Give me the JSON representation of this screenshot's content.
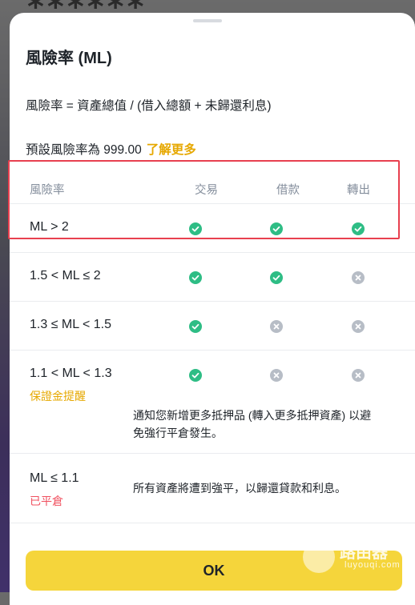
{
  "background": {
    "masked_text": "******"
  },
  "sheet": {
    "title": "風險率 (ML)",
    "formula": "風險率 = 資產總值 / (借入總額 + 未歸還利息)",
    "default_prefix": "預設風險率為 999.00",
    "learn_more": "了解更多"
  },
  "table": {
    "headers": [
      "風險率",
      "交易",
      "借款",
      "轉出"
    ],
    "rows": [
      {
        "ml": "ML > 2",
        "trade": "ok",
        "borrow": "ok",
        "transfer": "ok",
        "tag": "",
        "note": ""
      },
      {
        "ml": "1.5 < ML ≤ 2",
        "trade": "ok",
        "borrow": "ok",
        "transfer": "no",
        "tag": "",
        "note": ""
      },
      {
        "ml": "1.3 ≤ ML < 1.5",
        "trade": "ok",
        "borrow": "no",
        "transfer": "no",
        "tag": "",
        "note": ""
      },
      {
        "ml": "1.1 < ML < 1.3",
        "trade": "ok",
        "borrow": "no",
        "transfer": "no",
        "tag": "保證金提醒",
        "note_line1": "通知您新增更多抵押品 (轉入更多抵押資產) 以避",
        "note_line2": "免強行平倉發生。"
      },
      {
        "ml": "ML ≤ 1.1",
        "tag": "已平倉",
        "note": "所有資產將遭到強平，以歸還貸款和利息。"
      }
    ]
  },
  "ok_button": "OK",
  "watermark": {
    "name": "路由器",
    "domain": "luyouqi.com"
  },
  "colors": {
    "accent": "#f5d53b",
    "link": "#e6a800",
    "success": "#2ebd85",
    "disabled": "#b7bdc6",
    "danger": "#f0505f",
    "highlight": "#e8404f"
  }
}
